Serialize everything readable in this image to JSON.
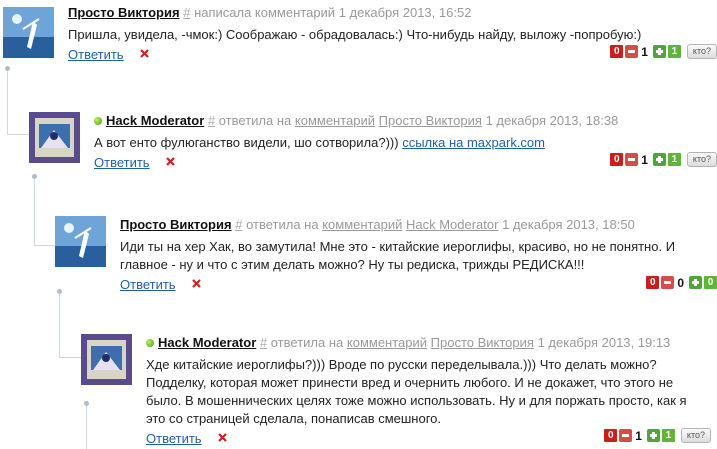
{
  "comments": [
    {
      "author": "Просто Виктория",
      "online": false,
      "hash": "#",
      "action": "написала комментарий",
      "target_word": "",
      "target_author": "",
      "date": "1 декабря 2013, 16:52",
      "text": "Пришла, увидела, -чмок:) Соображаю - обрадовалась:) Что-нибудь найду, выложу -попробую:)",
      "link_text": "",
      "reply_label": "Ответить",
      "votes": {
        "minus": "0",
        "score": "1",
        "plus": "1",
        "who": "кто?"
      }
    },
    {
      "author": "Hack Moderator",
      "online": true,
      "hash": "#",
      "action": "ответила на",
      "target_word": "комментарий",
      "target_author": "Просто Виктория",
      "date": "1 декабря 2013, 18:38",
      "text": "А вот енто фулюганство видели, шо сотворила?))) ",
      "link_text": "ссылка на maxpark.com",
      "reply_label": "Ответить",
      "votes": {
        "minus": "0",
        "score": "1",
        "plus": "1",
        "who": "кто?"
      }
    },
    {
      "author": "Просто Виктория",
      "online": false,
      "hash": "#",
      "action": "ответила на",
      "target_word": "комментарий",
      "target_author": "Hack Moderator",
      "date": "1 декабря 2013, 18:50",
      "text": " Иди ты на хер Хак, во замутила! Мне это - китайские иероглифы, красиво, но не понятно. И главное - ну и что с этим делать можно? Ну ты редиска, трижды РЕДИСКА!!!",
      "link_text": "",
      "reply_label": "Ответить",
      "votes": {
        "minus": "0",
        "score": "0",
        "plus": "0",
        "who": ""
      }
    },
    {
      "author": "Hack Moderator",
      "online": true,
      "hash": "#",
      "action": "ответила на",
      "target_word": "комментарий",
      "target_author": "Просто Виктория",
      "date": "1 декабря 2013, 19:13",
      "text": "Хде китайские иероглифы?))) Вроде по русски переделывала.))) Что делать можно? Подделку, которая может принести вред и очернить любого. И не докажет, что этого не было. В мошеннических целях тоже можно использовать. Ну и для поржать просто, как я это со страницей сделала, понаписав смешного.",
      "link_text": "",
      "reply_label": "Ответить",
      "votes": {
        "minus": "0",
        "score": "1",
        "plus": "1",
        "who": "кто?"
      }
    }
  ]
}
